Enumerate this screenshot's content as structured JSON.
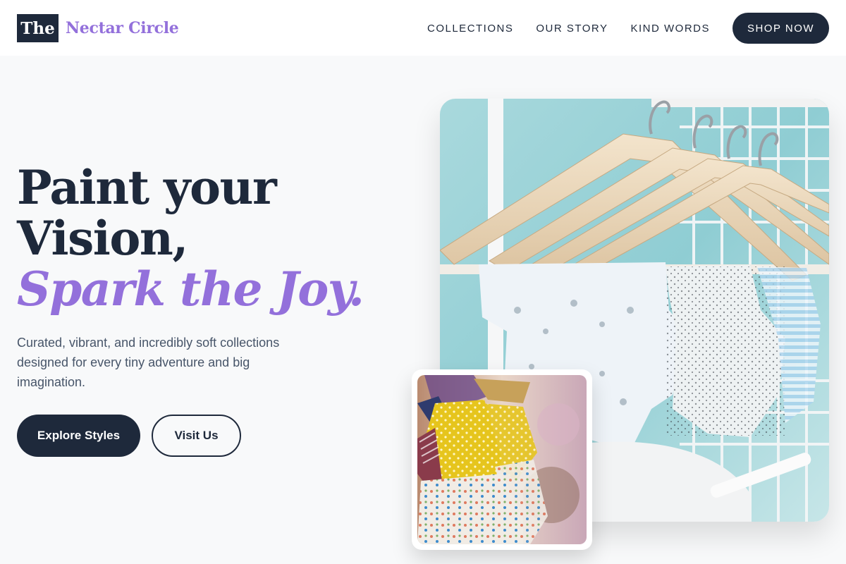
{
  "brand": {
    "logo_mark": "The",
    "name": "Nectar Circle"
  },
  "nav": {
    "links": [
      "COLLECTIONS",
      "OUR STORY",
      "KIND WORDS"
    ],
    "cta": "SHOP NOW"
  },
  "hero": {
    "title_line1": "Paint your",
    "title_line2": "Vision,",
    "title_accent": "Spark the Joy.",
    "description": "Curated, vibrant, and incredibly soft collections designed for every tiny adventure and big imagination.",
    "primary_button": "Explore Styles",
    "secondary_button": "Visit Us"
  },
  "images": {
    "main": "hangers-baby-clothes-photo",
    "secondary": "yellow-dresses-photo"
  },
  "colors": {
    "navy": "#1e293b",
    "lavender": "#9370db",
    "background": "#f8f9fa"
  }
}
